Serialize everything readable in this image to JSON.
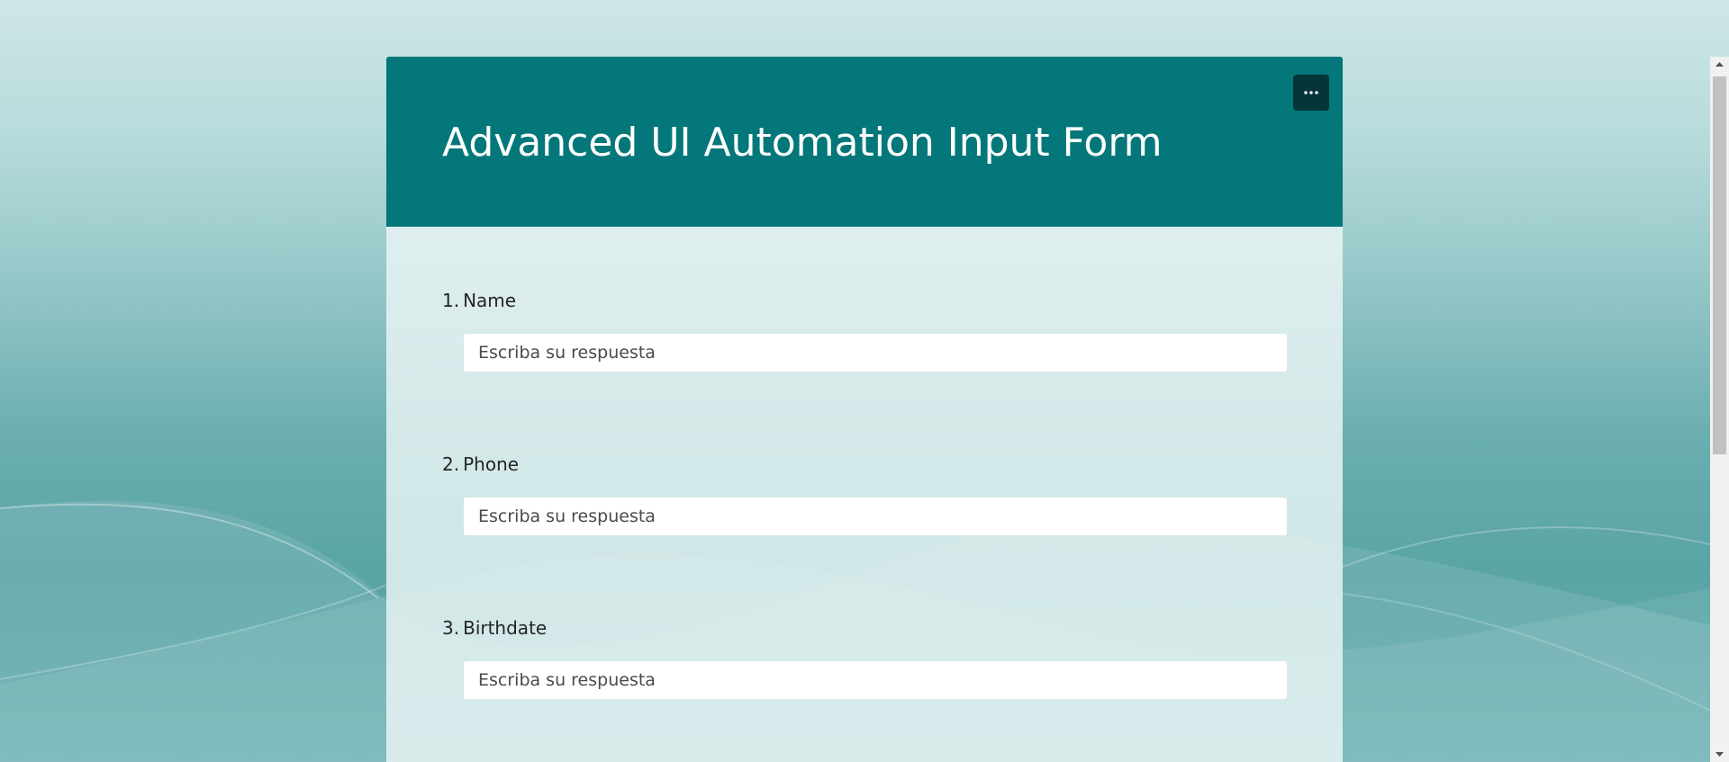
{
  "form": {
    "title": "Advanced UI Automation Input Form",
    "more_button_icon": "more-horizontal-icon",
    "questions": [
      {
        "number": "1.",
        "label": "Name",
        "placeholder": "Escriba su respuesta",
        "value": ""
      },
      {
        "number": "2.",
        "label": "Phone",
        "placeholder": "Escriba su respuesta",
        "value": ""
      },
      {
        "number": "3.",
        "label": "Birthdate",
        "placeholder": "Escriba su respuesta",
        "value": ""
      }
    ]
  },
  "colors": {
    "header_bg": "#037779",
    "more_button_bg": "#053538",
    "page_bg_top": "#cfe6e6",
    "page_bg_bottom": "#5aa4a6"
  }
}
